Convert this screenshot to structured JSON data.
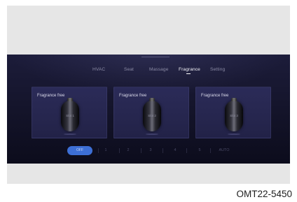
{
  "tabs": [
    {
      "label": "HVAC",
      "active": false
    },
    {
      "label": "Seat",
      "active": false
    },
    {
      "label": "Massage",
      "active": false
    },
    {
      "label": "Fragrance",
      "active": true
    },
    {
      "label": "Setting",
      "active": false
    }
  ],
  "slots": [
    {
      "title": "Fragrance free",
      "label": "Slot 1"
    },
    {
      "title": "Fragrance free",
      "label": "Slot 2"
    },
    {
      "title": "Fragrance free",
      "label": "Slot 3"
    }
  ],
  "levels": {
    "off_label": "OFF",
    "items": [
      "1",
      "2",
      "3",
      "4",
      "5",
      "AUTO"
    ]
  },
  "caption": "OMT22-5450",
  "colors": {
    "screen_bg": "#15152c",
    "card_bg": "#2b2b58",
    "accent": "#3d6fd6"
  }
}
